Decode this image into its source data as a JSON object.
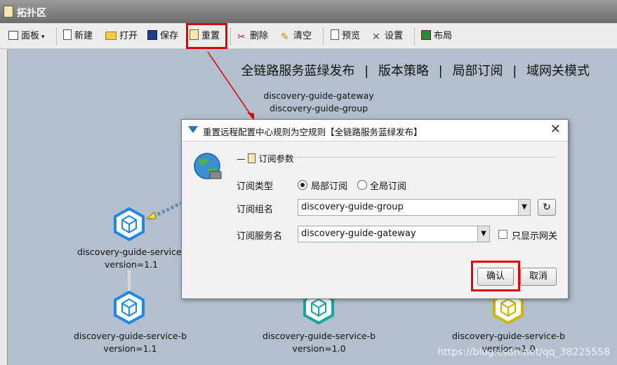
{
  "window": {
    "title": "拓扑区"
  },
  "toolbar": {
    "panel": "面板",
    "new": "新建",
    "open": "打开",
    "save": "保存",
    "reset": "重置",
    "delete": "删除",
    "clear": "清空",
    "preview": "预览",
    "settings": "设置",
    "layout": "布局"
  },
  "canvas": {
    "links": [
      "全链路服务蓝绿发布",
      "版本策略",
      "局部订阅",
      "域网关模式"
    ],
    "link_sep": "|",
    "top_node": {
      "line1": "discovery-guide-gateway",
      "line2": "discovery-guide-group"
    },
    "nodes": [
      {
        "name": "discovery-guide-service-a",
        "version": "version=1.1",
        "color": "#1e88e5"
      },
      {
        "name": "discovery-guide-service-b",
        "version": "version=1.1",
        "color": "#1e88e5"
      },
      {
        "name": "discovery-guide-service-b",
        "version": "version=1.0",
        "color": "#1aa3a3"
      },
      {
        "name": "discovery-guide-service-b",
        "version": "version=1.0",
        "color": "#c9b400"
      }
    ],
    "watermark": "https://blog.csdn.net/qq_38225558"
  },
  "dialog": {
    "title": "重置远程配置中心规则为空规则【全链路服务蓝绿发布】",
    "group_title": "订阅参数",
    "type_label": "订阅类型",
    "radio_partial": "局部订阅",
    "radio_global": "全局订阅",
    "group_label": "订阅组名",
    "group_value": "discovery-guide-group",
    "service_label": "订阅服务名",
    "service_value": "discovery-guide-gateway",
    "gateway_only": "只显示网关",
    "confirm": "确认",
    "cancel": "取消"
  }
}
